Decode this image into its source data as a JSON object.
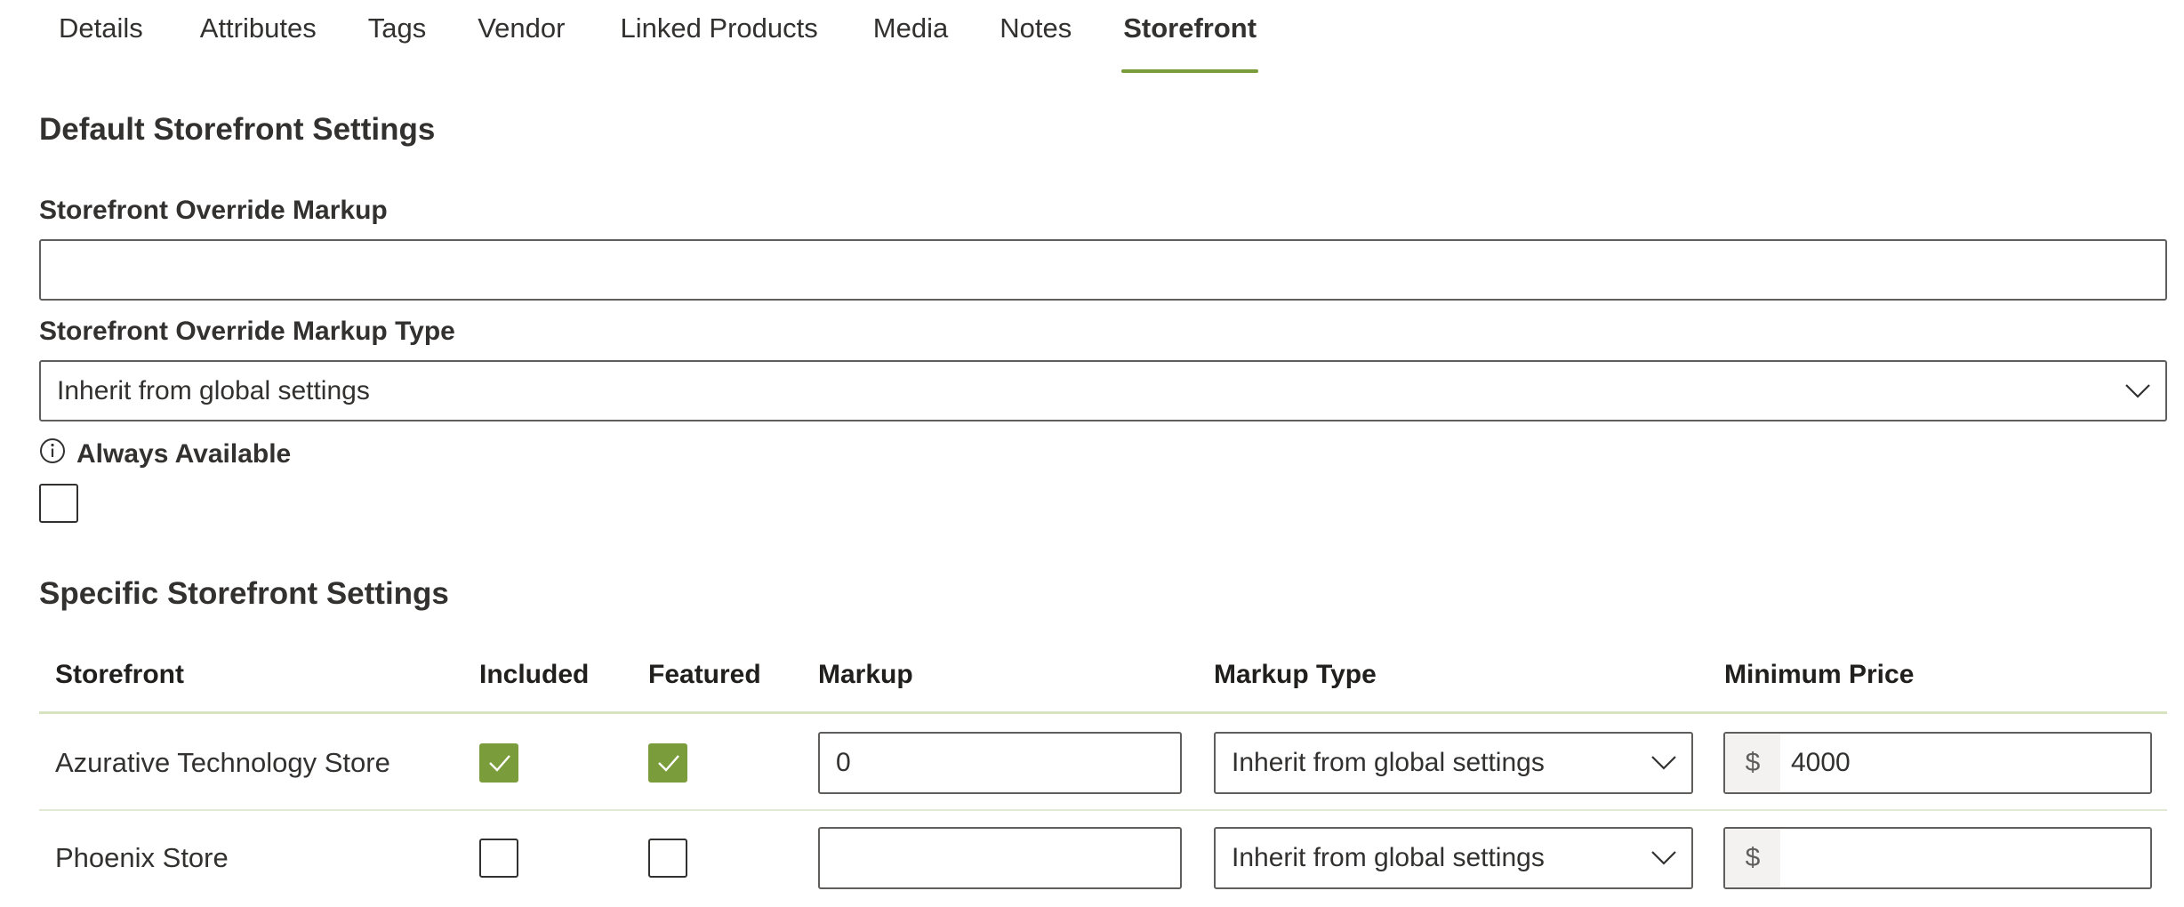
{
  "tabs": [
    {
      "label": "Details"
    },
    {
      "label": "Attributes"
    },
    {
      "label": "Tags"
    },
    {
      "label": "Vendor"
    },
    {
      "label": "Linked Products"
    },
    {
      "label": "Media"
    },
    {
      "label": "Notes"
    },
    {
      "label": "Storefront",
      "active": true
    }
  ],
  "default_settings": {
    "title": "Default Storefront Settings",
    "markup_label": "Storefront Override Markup",
    "markup_value": "",
    "markup_type_label": "Storefront Override Markup Type",
    "markup_type_value": "Inherit from global settings",
    "always_available_label": "Always Available",
    "always_available_checked": false
  },
  "specific_settings": {
    "title": "Specific Storefront Settings",
    "columns": [
      "Storefront",
      "Included",
      "Featured",
      "Markup",
      "Markup Type",
      "Minimum Price"
    ],
    "currency_symbol": "$",
    "rows": [
      {
        "storefront": "Azurative Technology Store",
        "included": true,
        "featured": true,
        "markup": "0",
        "markup_type": "Inherit from global settings",
        "minimum_price": "4000"
      },
      {
        "storefront": "Phoenix Store",
        "included": false,
        "featured": false,
        "markup": "",
        "markup_type": "Inherit from global settings",
        "minimum_price": ""
      }
    ]
  },
  "colors": {
    "accent": "#7a9c3a",
    "text": "#323130",
    "border": "#605e5c",
    "rule": "#d6e2c0"
  },
  "icons": {
    "info": "info-icon",
    "chevron": "chevron-down-icon",
    "check": "checkmark-icon"
  }
}
